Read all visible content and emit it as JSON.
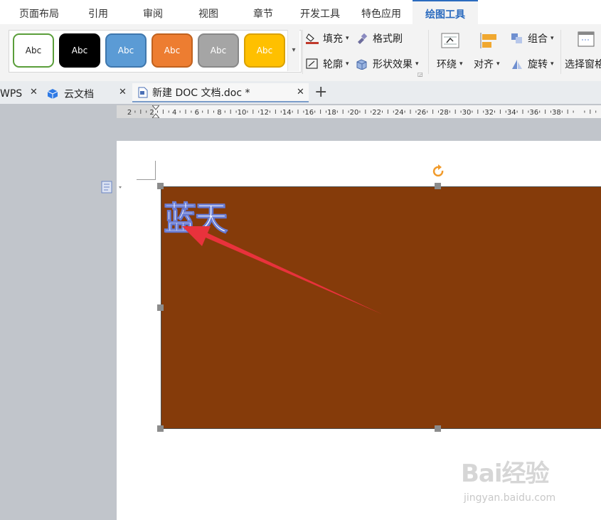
{
  "menu": {
    "tabs": [
      {
        "label": "页面布局"
      },
      {
        "label": "引用"
      },
      {
        "label": "审阅"
      },
      {
        "label": "视图"
      },
      {
        "label": "章节"
      },
      {
        "label": "开发工具"
      },
      {
        "label": "特色应用"
      },
      {
        "label": "绘图工具"
      }
    ],
    "active_tab": "绘图工具"
  },
  "ribbon": {
    "style_gallery": {
      "items": [
        {
          "label": "Abc",
          "fill": "#ffffff",
          "border": "#5a9e3a",
          "text_color": "#222222"
        },
        {
          "label": "Abc",
          "fill": "#000000",
          "border": "#000000",
          "text_color": "#ffffff"
        },
        {
          "label": "Abc",
          "fill": "#5b9bd5",
          "border": "#3f77ad",
          "text_color": "#ffffff"
        },
        {
          "label": "Abc",
          "fill": "#ed7d31",
          "border": "#c0621f",
          "text_color": "#ffffff"
        },
        {
          "label": "Abc",
          "fill": "#a5a5a5",
          "border": "#888888",
          "text_color": "#ffffff"
        },
        {
          "label": "Abc",
          "fill": "#ffc000",
          "border": "#d9a100",
          "text_color": "#ffffff"
        }
      ],
      "more_icon": "triangle-down-icon"
    },
    "fill_label": "填充",
    "format_painter_label": "格式刷",
    "outline_label": "轮廓",
    "shape_effects_label": "形状效果",
    "wrap_label": "环绕",
    "align_label": "对齐",
    "group_label": "组合",
    "rotate_label": "旋转",
    "selection_pane_label": "选择窗格"
  },
  "doc_tabs": {
    "tabs": [
      {
        "label": "WPS"
      },
      {
        "label": "云文档"
      },
      {
        "label": "新建 DOC 文档.doc *"
      }
    ],
    "new_tab_icon": "plus-icon"
  },
  "ruler": {
    "labels": [
      "2",
      "2",
      "4",
      "6",
      "8",
      "10",
      "12",
      "14",
      "16",
      "18",
      "20",
      "22",
      "24",
      "26",
      "28",
      "30",
      "32",
      "34",
      "36",
      "38"
    ]
  },
  "document": {
    "shape_text": "蓝天",
    "shape_fill": "#853b0a"
  },
  "watermark": {
    "logo": "Bai经验",
    "url": "jingyan.baidu.com"
  },
  "colors": {
    "accent": "#2b6bbf",
    "annotation_arrow": "#e8323c"
  }
}
